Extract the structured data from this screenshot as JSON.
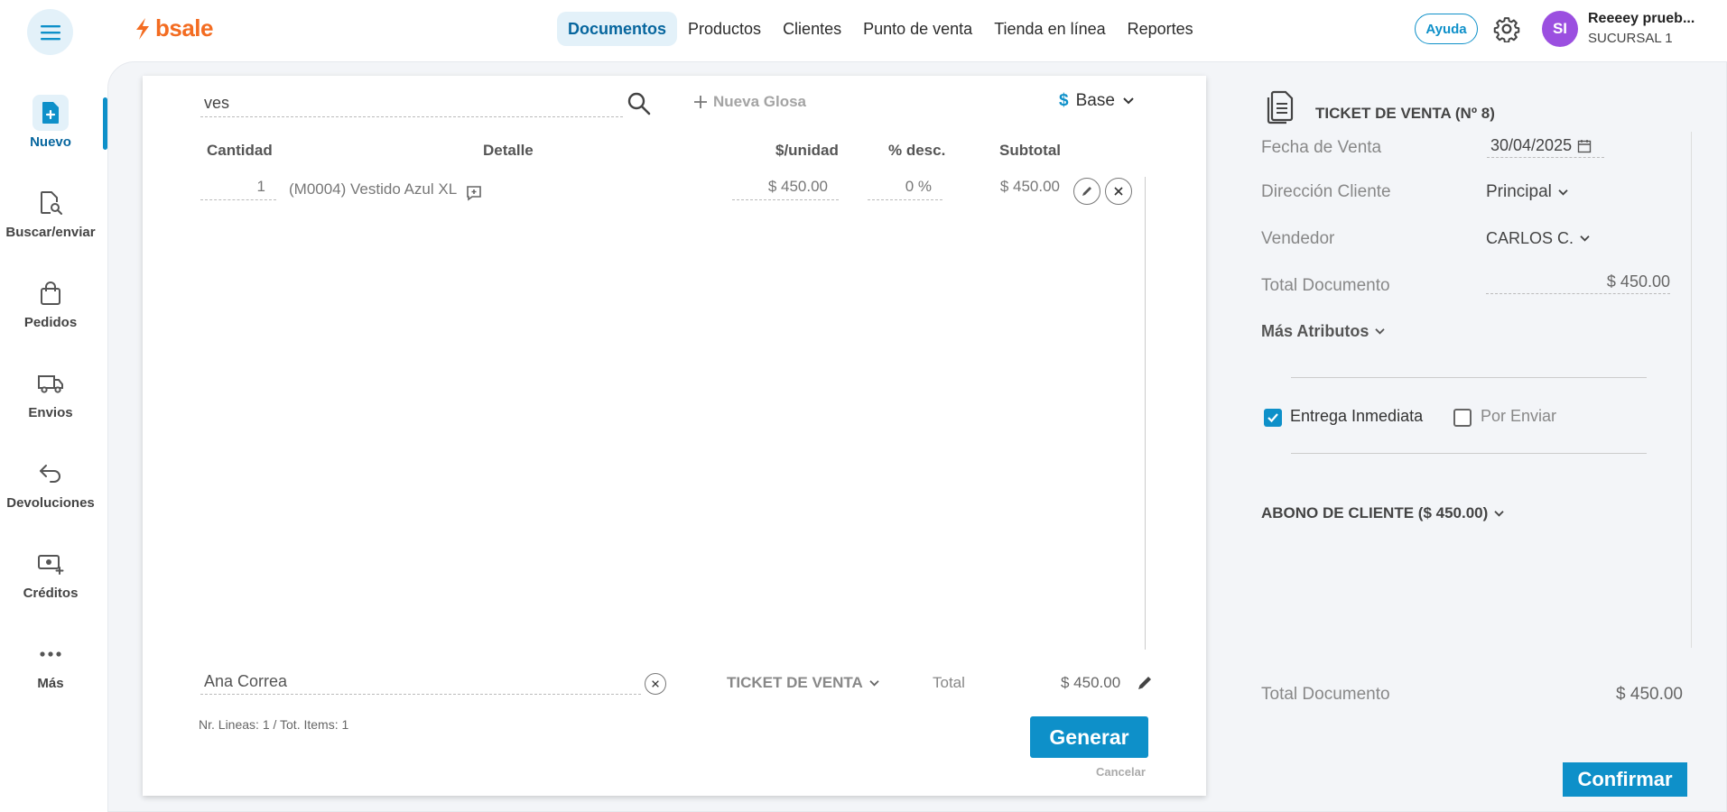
{
  "brand": {
    "name": "bsale",
    "color": "#f36c21",
    "accent": "#0e90c9"
  },
  "nav": {
    "items": [
      {
        "label": "Documentos",
        "active": true
      },
      {
        "label": "Productos"
      },
      {
        "label": "Clientes"
      },
      {
        "label": "Punto de venta"
      },
      {
        "label": "Tienda en línea"
      },
      {
        "label": "Reportes"
      }
    ]
  },
  "header": {
    "help_label": "Ayuda",
    "user_initials": "SI",
    "user_name": "Reeeey prueb...",
    "user_branch": "SUCURSAL 1"
  },
  "sidebar": {
    "items": [
      {
        "label": "Nuevo",
        "icon": "new-document-icon",
        "active": true
      },
      {
        "label": "Buscar/enviar",
        "icon": "search-document-icon"
      },
      {
        "label": "Pedidos",
        "icon": "shopping-bag-icon"
      },
      {
        "label": "Envios",
        "icon": "truck-icon"
      },
      {
        "label": "Devoluciones",
        "icon": "return-arrow-icon"
      },
      {
        "label": "Créditos",
        "icon": "cash-plus-icon"
      },
      {
        "label": "Más",
        "icon": "more-dots-icon"
      }
    ]
  },
  "editor": {
    "search_value": "ves",
    "new_gloss_label": "Nueva Glosa",
    "currency_symbol": "$",
    "price_list": "Base",
    "columns": {
      "qty": "Cantidad",
      "detail": "Detalle",
      "unit_price": "$/unidad",
      "discount": "% desc.",
      "subtotal": "Subtotal"
    },
    "lines": [
      {
        "qty": "1",
        "detail": "(M0004) Vestido Azul XL",
        "unit_price": "$ 450.00",
        "discount": "0 %",
        "subtotal": "$ 450.00"
      }
    ],
    "client_name": "Ana Correa",
    "document_type": "TICKET DE VENTA",
    "total_label": "Total",
    "total_value": "$ 450.00",
    "counts": "Nr. Lineas: 1 / Tot. Items: 1",
    "generate_label": "Generar",
    "cancel_label": "Cancelar"
  },
  "summary": {
    "title": "TICKET DE VENTA (Nº 8)",
    "sale_date_label": "Fecha de Venta",
    "sale_date": "30/04/2025",
    "client_address_label": "Dirección Cliente",
    "client_address": "Principal",
    "seller_label": "Vendedor",
    "seller": "CARLOS C.",
    "doc_total_label": "Total Documento",
    "doc_total": "$ 450.00",
    "more_attributes_label": "Más Atributos",
    "immediate_delivery_label": "Entrega Inmediata",
    "immediate_delivery_checked": true,
    "to_ship_label": "Por Enviar",
    "to_ship_checked": false,
    "client_payment_label": "ABONO DE CLIENTE ($ 450.00)",
    "footer_total_label": "Total Documento",
    "footer_total": "$ 450.00",
    "confirm_label": "Confirmar"
  }
}
